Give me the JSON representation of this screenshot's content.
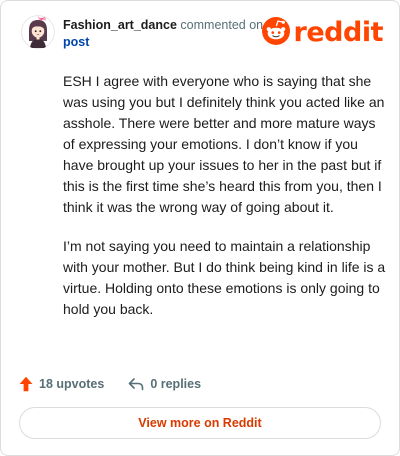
{
  "comment": {
    "author": "Fashion_art_dance",
    "action_text": "commented on",
    "post_link": "post",
    "paragraphs": [
      "ESH I agree with everyone who is saying that she was using you but I definitely think you acted like an asshole. There were better and more mature ways of expressing your emotions. I don’t know if you have brought up your issues to her in the past but if this is the first time she’s heard this from you, then I think it was the wrong way of going about it.",
      "I’m not saying you need to maintain a relationship with your mother. But I do think being kind in life is a virtue. Holding onto these emotions is only going to hold you back."
    ]
  },
  "brand": {
    "name": "reddit",
    "color": "#ff4500"
  },
  "actions": {
    "upvotes": "18 upvotes",
    "replies": "0 replies"
  },
  "view_button": "View more on Reddit",
  "icons": {
    "avatar": "avatar-icon",
    "logo": "reddit-snoo-icon",
    "upvote": "upvote-arrow-icon",
    "reply": "reply-arrow-icon"
  },
  "colors": {
    "upvote": "#ff4500",
    "link": "#0045ac",
    "button_text": "#d93a00",
    "muted": "#576f76"
  }
}
